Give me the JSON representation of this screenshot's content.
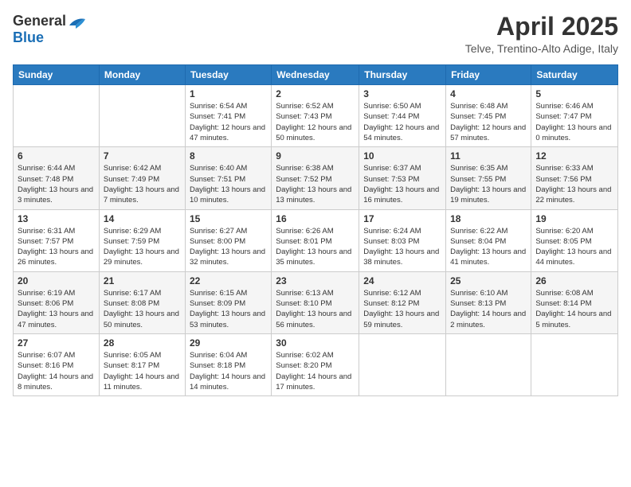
{
  "header": {
    "logo_general": "General",
    "logo_blue": "Blue",
    "month_title": "April 2025",
    "location": "Telve, Trentino-Alto Adige, Italy"
  },
  "days_of_week": [
    "Sunday",
    "Monday",
    "Tuesday",
    "Wednesday",
    "Thursday",
    "Friday",
    "Saturday"
  ],
  "weeks": [
    [
      {
        "day": "",
        "detail": ""
      },
      {
        "day": "",
        "detail": ""
      },
      {
        "day": "1",
        "detail": "Sunrise: 6:54 AM\nSunset: 7:41 PM\nDaylight: 12 hours and 47 minutes."
      },
      {
        "day": "2",
        "detail": "Sunrise: 6:52 AM\nSunset: 7:43 PM\nDaylight: 12 hours and 50 minutes."
      },
      {
        "day": "3",
        "detail": "Sunrise: 6:50 AM\nSunset: 7:44 PM\nDaylight: 12 hours and 54 minutes."
      },
      {
        "day": "4",
        "detail": "Sunrise: 6:48 AM\nSunset: 7:45 PM\nDaylight: 12 hours and 57 minutes."
      },
      {
        "day": "5",
        "detail": "Sunrise: 6:46 AM\nSunset: 7:47 PM\nDaylight: 13 hours and 0 minutes."
      }
    ],
    [
      {
        "day": "6",
        "detail": "Sunrise: 6:44 AM\nSunset: 7:48 PM\nDaylight: 13 hours and 3 minutes."
      },
      {
        "day": "7",
        "detail": "Sunrise: 6:42 AM\nSunset: 7:49 PM\nDaylight: 13 hours and 7 minutes."
      },
      {
        "day": "8",
        "detail": "Sunrise: 6:40 AM\nSunset: 7:51 PM\nDaylight: 13 hours and 10 minutes."
      },
      {
        "day": "9",
        "detail": "Sunrise: 6:38 AM\nSunset: 7:52 PM\nDaylight: 13 hours and 13 minutes."
      },
      {
        "day": "10",
        "detail": "Sunrise: 6:37 AM\nSunset: 7:53 PM\nDaylight: 13 hours and 16 minutes."
      },
      {
        "day": "11",
        "detail": "Sunrise: 6:35 AM\nSunset: 7:55 PM\nDaylight: 13 hours and 19 minutes."
      },
      {
        "day": "12",
        "detail": "Sunrise: 6:33 AM\nSunset: 7:56 PM\nDaylight: 13 hours and 22 minutes."
      }
    ],
    [
      {
        "day": "13",
        "detail": "Sunrise: 6:31 AM\nSunset: 7:57 PM\nDaylight: 13 hours and 26 minutes."
      },
      {
        "day": "14",
        "detail": "Sunrise: 6:29 AM\nSunset: 7:59 PM\nDaylight: 13 hours and 29 minutes."
      },
      {
        "day": "15",
        "detail": "Sunrise: 6:27 AM\nSunset: 8:00 PM\nDaylight: 13 hours and 32 minutes."
      },
      {
        "day": "16",
        "detail": "Sunrise: 6:26 AM\nSunset: 8:01 PM\nDaylight: 13 hours and 35 minutes."
      },
      {
        "day": "17",
        "detail": "Sunrise: 6:24 AM\nSunset: 8:03 PM\nDaylight: 13 hours and 38 minutes."
      },
      {
        "day": "18",
        "detail": "Sunrise: 6:22 AM\nSunset: 8:04 PM\nDaylight: 13 hours and 41 minutes."
      },
      {
        "day": "19",
        "detail": "Sunrise: 6:20 AM\nSunset: 8:05 PM\nDaylight: 13 hours and 44 minutes."
      }
    ],
    [
      {
        "day": "20",
        "detail": "Sunrise: 6:19 AM\nSunset: 8:06 PM\nDaylight: 13 hours and 47 minutes."
      },
      {
        "day": "21",
        "detail": "Sunrise: 6:17 AM\nSunset: 8:08 PM\nDaylight: 13 hours and 50 minutes."
      },
      {
        "day": "22",
        "detail": "Sunrise: 6:15 AM\nSunset: 8:09 PM\nDaylight: 13 hours and 53 minutes."
      },
      {
        "day": "23",
        "detail": "Sunrise: 6:13 AM\nSunset: 8:10 PM\nDaylight: 13 hours and 56 minutes."
      },
      {
        "day": "24",
        "detail": "Sunrise: 6:12 AM\nSunset: 8:12 PM\nDaylight: 13 hours and 59 minutes."
      },
      {
        "day": "25",
        "detail": "Sunrise: 6:10 AM\nSunset: 8:13 PM\nDaylight: 14 hours and 2 minutes."
      },
      {
        "day": "26",
        "detail": "Sunrise: 6:08 AM\nSunset: 8:14 PM\nDaylight: 14 hours and 5 minutes."
      }
    ],
    [
      {
        "day": "27",
        "detail": "Sunrise: 6:07 AM\nSunset: 8:16 PM\nDaylight: 14 hours and 8 minutes."
      },
      {
        "day": "28",
        "detail": "Sunrise: 6:05 AM\nSunset: 8:17 PM\nDaylight: 14 hours and 11 minutes."
      },
      {
        "day": "29",
        "detail": "Sunrise: 6:04 AM\nSunset: 8:18 PM\nDaylight: 14 hours and 14 minutes."
      },
      {
        "day": "30",
        "detail": "Sunrise: 6:02 AM\nSunset: 8:20 PM\nDaylight: 14 hours and 17 minutes."
      },
      {
        "day": "",
        "detail": ""
      },
      {
        "day": "",
        "detail": ""
      },
      {
        "day": "",
        "detail": ""
      }
    ]
  ]
}
